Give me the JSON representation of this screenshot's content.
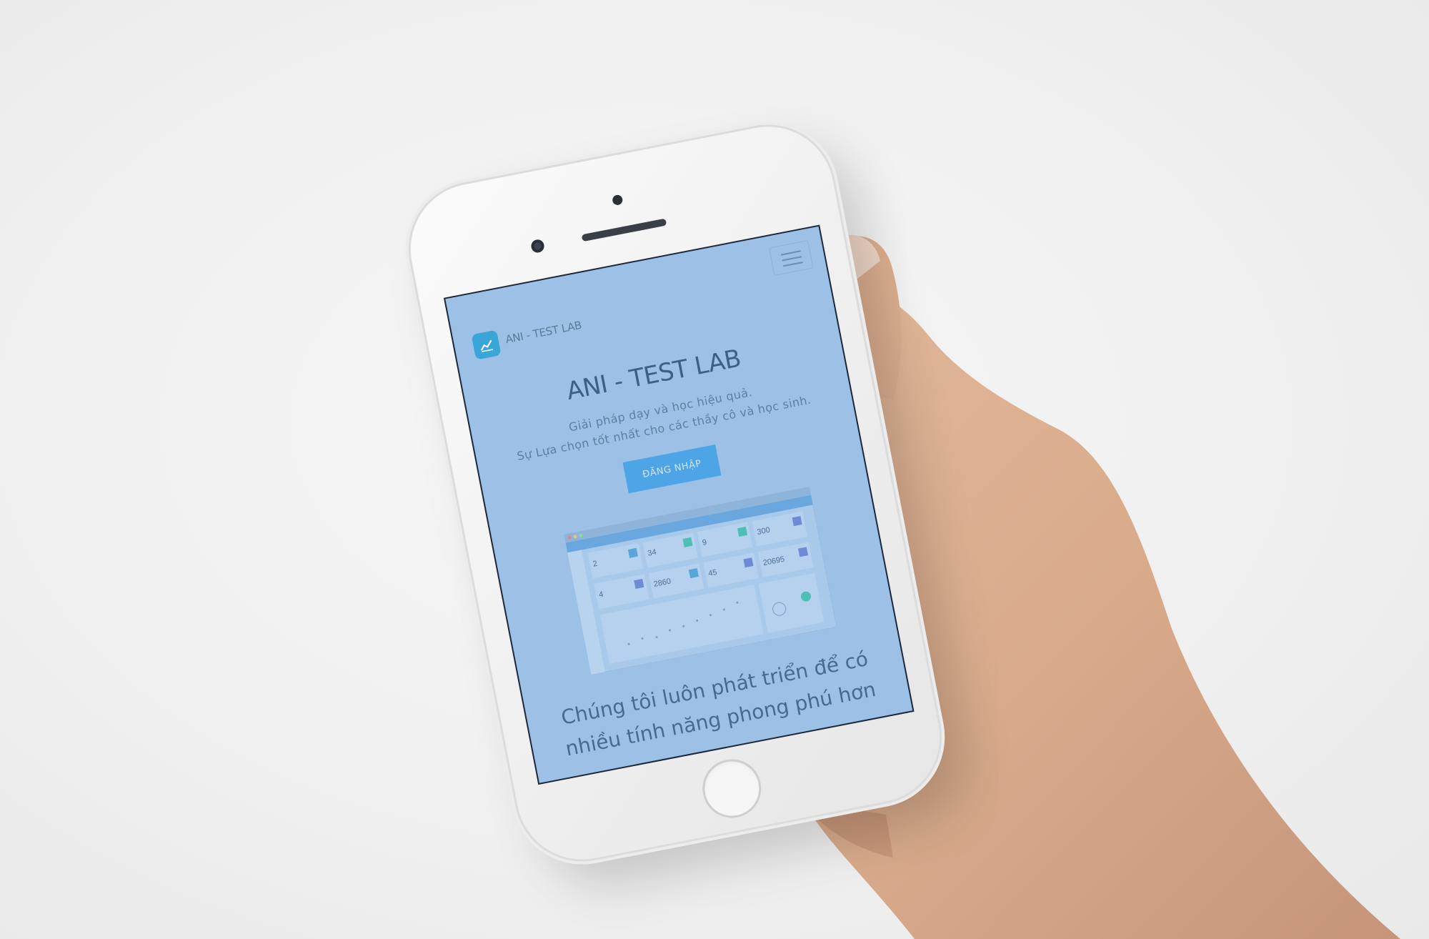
{
  "app": {
    "logo_text": "ANI - TEST LAB",
    "hero_title": "ANI - TEST LAB",
    "hero_line1": "Giải pháp dạy và học hiệu quả.",
    "hero_line2": "Sự Lựa chọn tốt nhất cho các thầy cô và học sinh.",
    "login_button": "ĐĂNG NHẬP",
    "section_heading_line1": "Chúng tôi luôn phát triển để có",
    "section_heading_line2": "nhiều tính năng phong phú hơn"
  },
  "dashboard_preview": {
    "stats": [
      "2",
      "34",
      "9",
      "300",
      "4",
      "2860",
      "45",
      "20695"
    ]
  },
  "icons": {
    "logo": "chart-line-icon",
    "menu": "hamburger-menu-icon"
  },
  "colors": {
    "screen_bg": "#9dc1e6",
    "accent": "#4ea5e6",
    "logo_bg": "#3aa6d8"
  }
}
